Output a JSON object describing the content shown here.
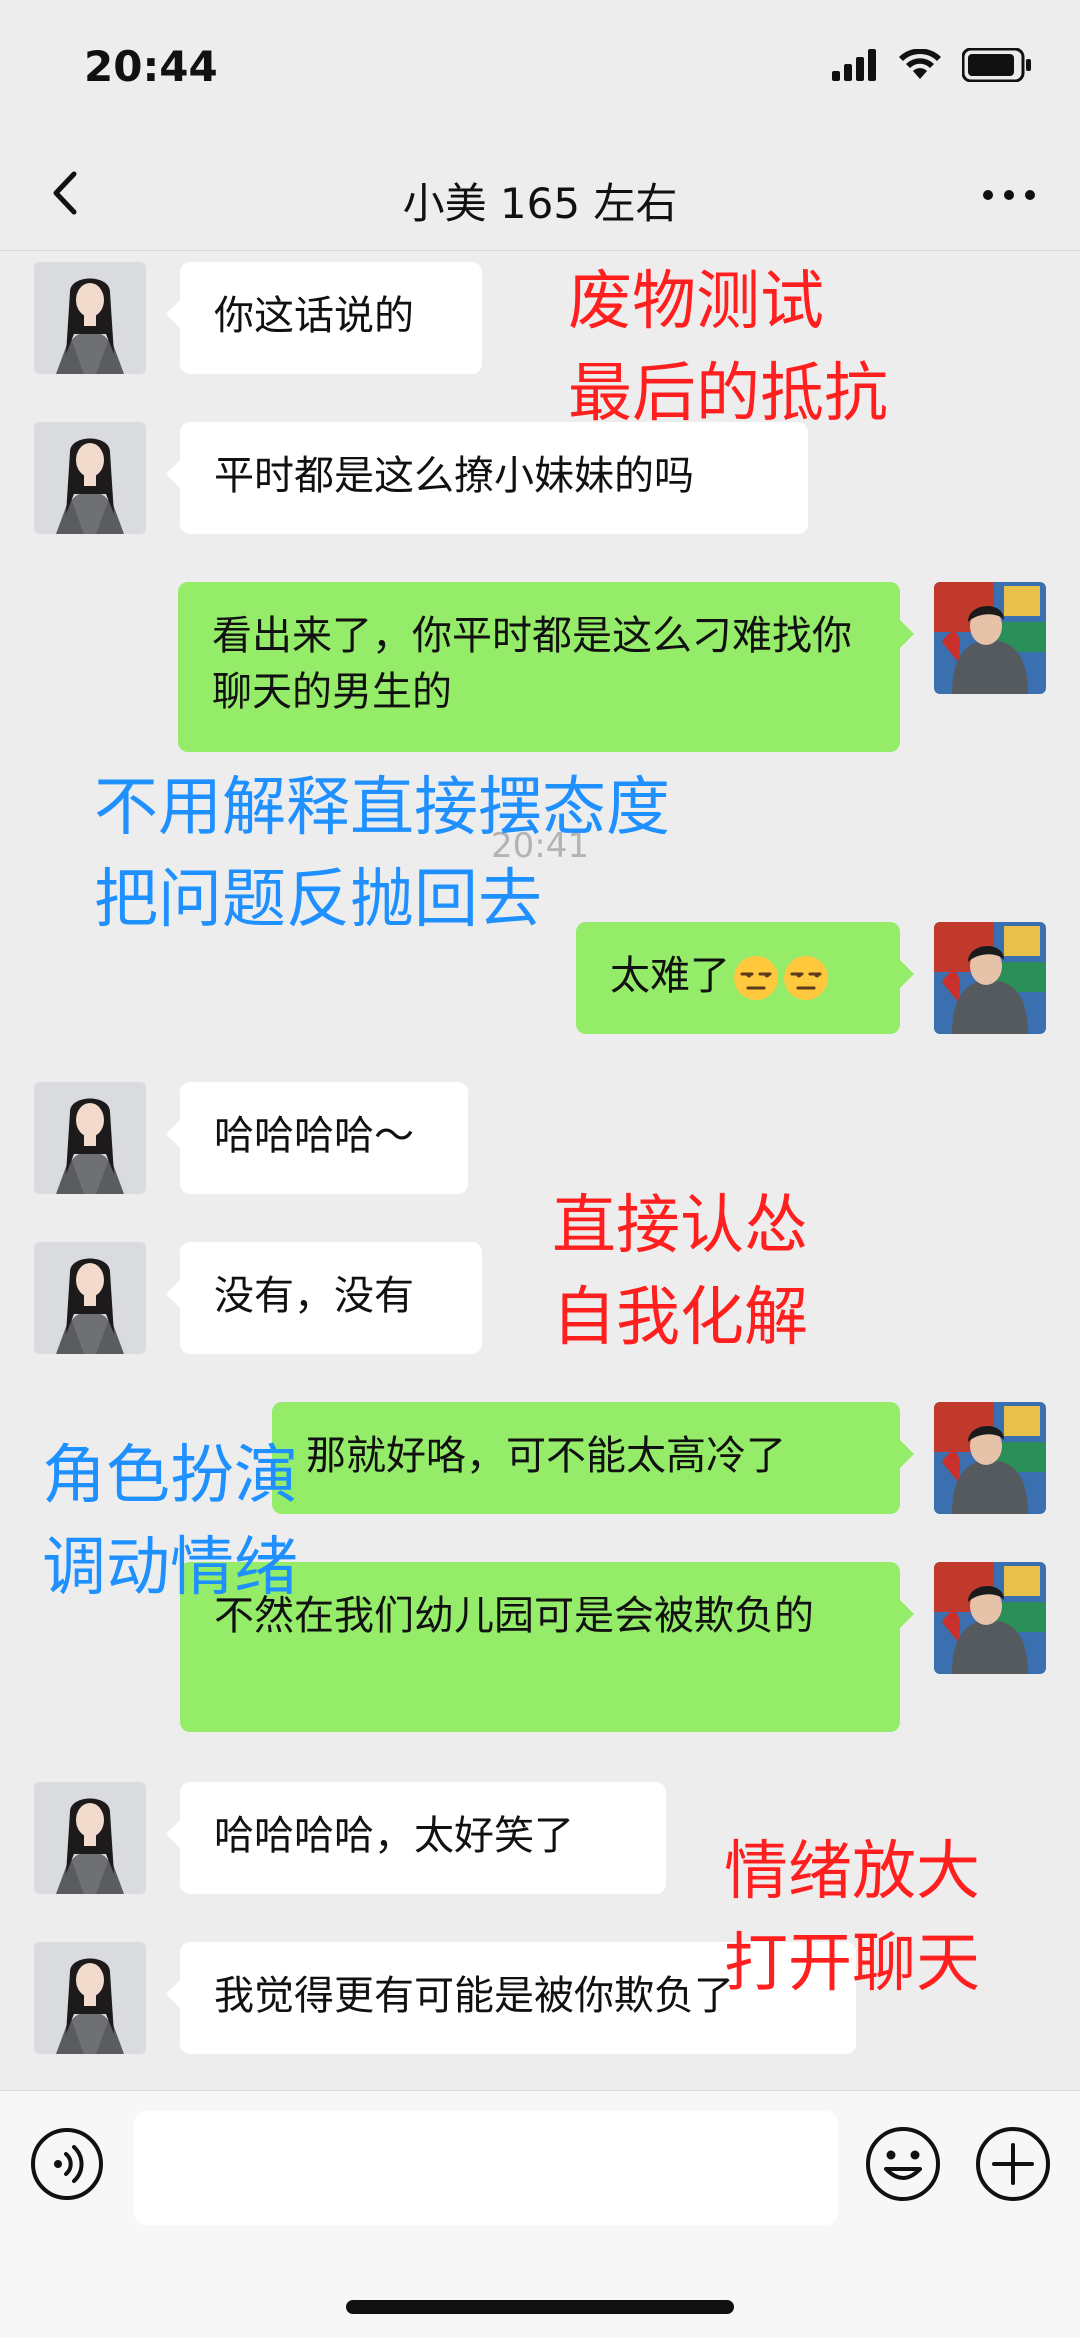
{
  "status": {
    "time": "20:44"
  },
  "header": {
    "title": "小美 165 左右"
  },
  "messages": [
    {
      "side": "in",
      "text": "你这话说的"
    },
    {
      "side": "in",
      "text": "平时都是这么撩小妹妹的吗"
    },
    {
      "side": "out",
      "text": "看出来了，你平时都是这么刁难找你聊天的男生的"
    },
    {
      "side": "out",
      "text": "太难了",
      "emoji": "😒😒"
    },
    {
      "side": "in",
      "text": "哈哈哈哈～"
    },
    {
      "side": "in",
      "text": "没有，没有"
    },
    {
      "side": "out",
      "text": "那就好咯，可不能太高冷了"
    },
    {
      "side": "out",
      "text": "不然在我们幼儿园可是会被欺负的"
    },
    {
      "side": "in",
      "text": "哈哈哈哈，太好笑了"
    },
    {
      "side": "in",
      "text": "我觉得更有可能是被你欺负了"
    }
  ],
  "timestamp": "20:41",
  "annotations": [
    {
      "color": "red",
      "text": "废物测试\n最后的抵抗"
    },
    {
      "color": "blue",
      "text": "不用解释直接摆态度\n把问题反抛回去"
    },
    {
      "color": "red",
      "text": "直接认怂\n自我化解"
    },
    {
      "color": "blue",
      "text": "角色扮演\n调动情绪"
    },
    {
      "color": "red",
      "text": "情绪放大\n打开聊天"
    }
  ],
  "input": {
    "value": ""
  },
  "colors": {
    "bubble_out": "#95ec69",
    "bubble_in": "#ffffff",
    "background": "#ededed",
    "note_red": "#ff1f1f",
    "note_blue": "#1e90ff"
  },
  "icons": [
    "back-icon",
    "more-icon",
    "voice-icon",
    "emoji-icon",
    "plus-icon",
    "signal-icon",
    "wifi-icon",
    "battery-icon"
  ]
}
